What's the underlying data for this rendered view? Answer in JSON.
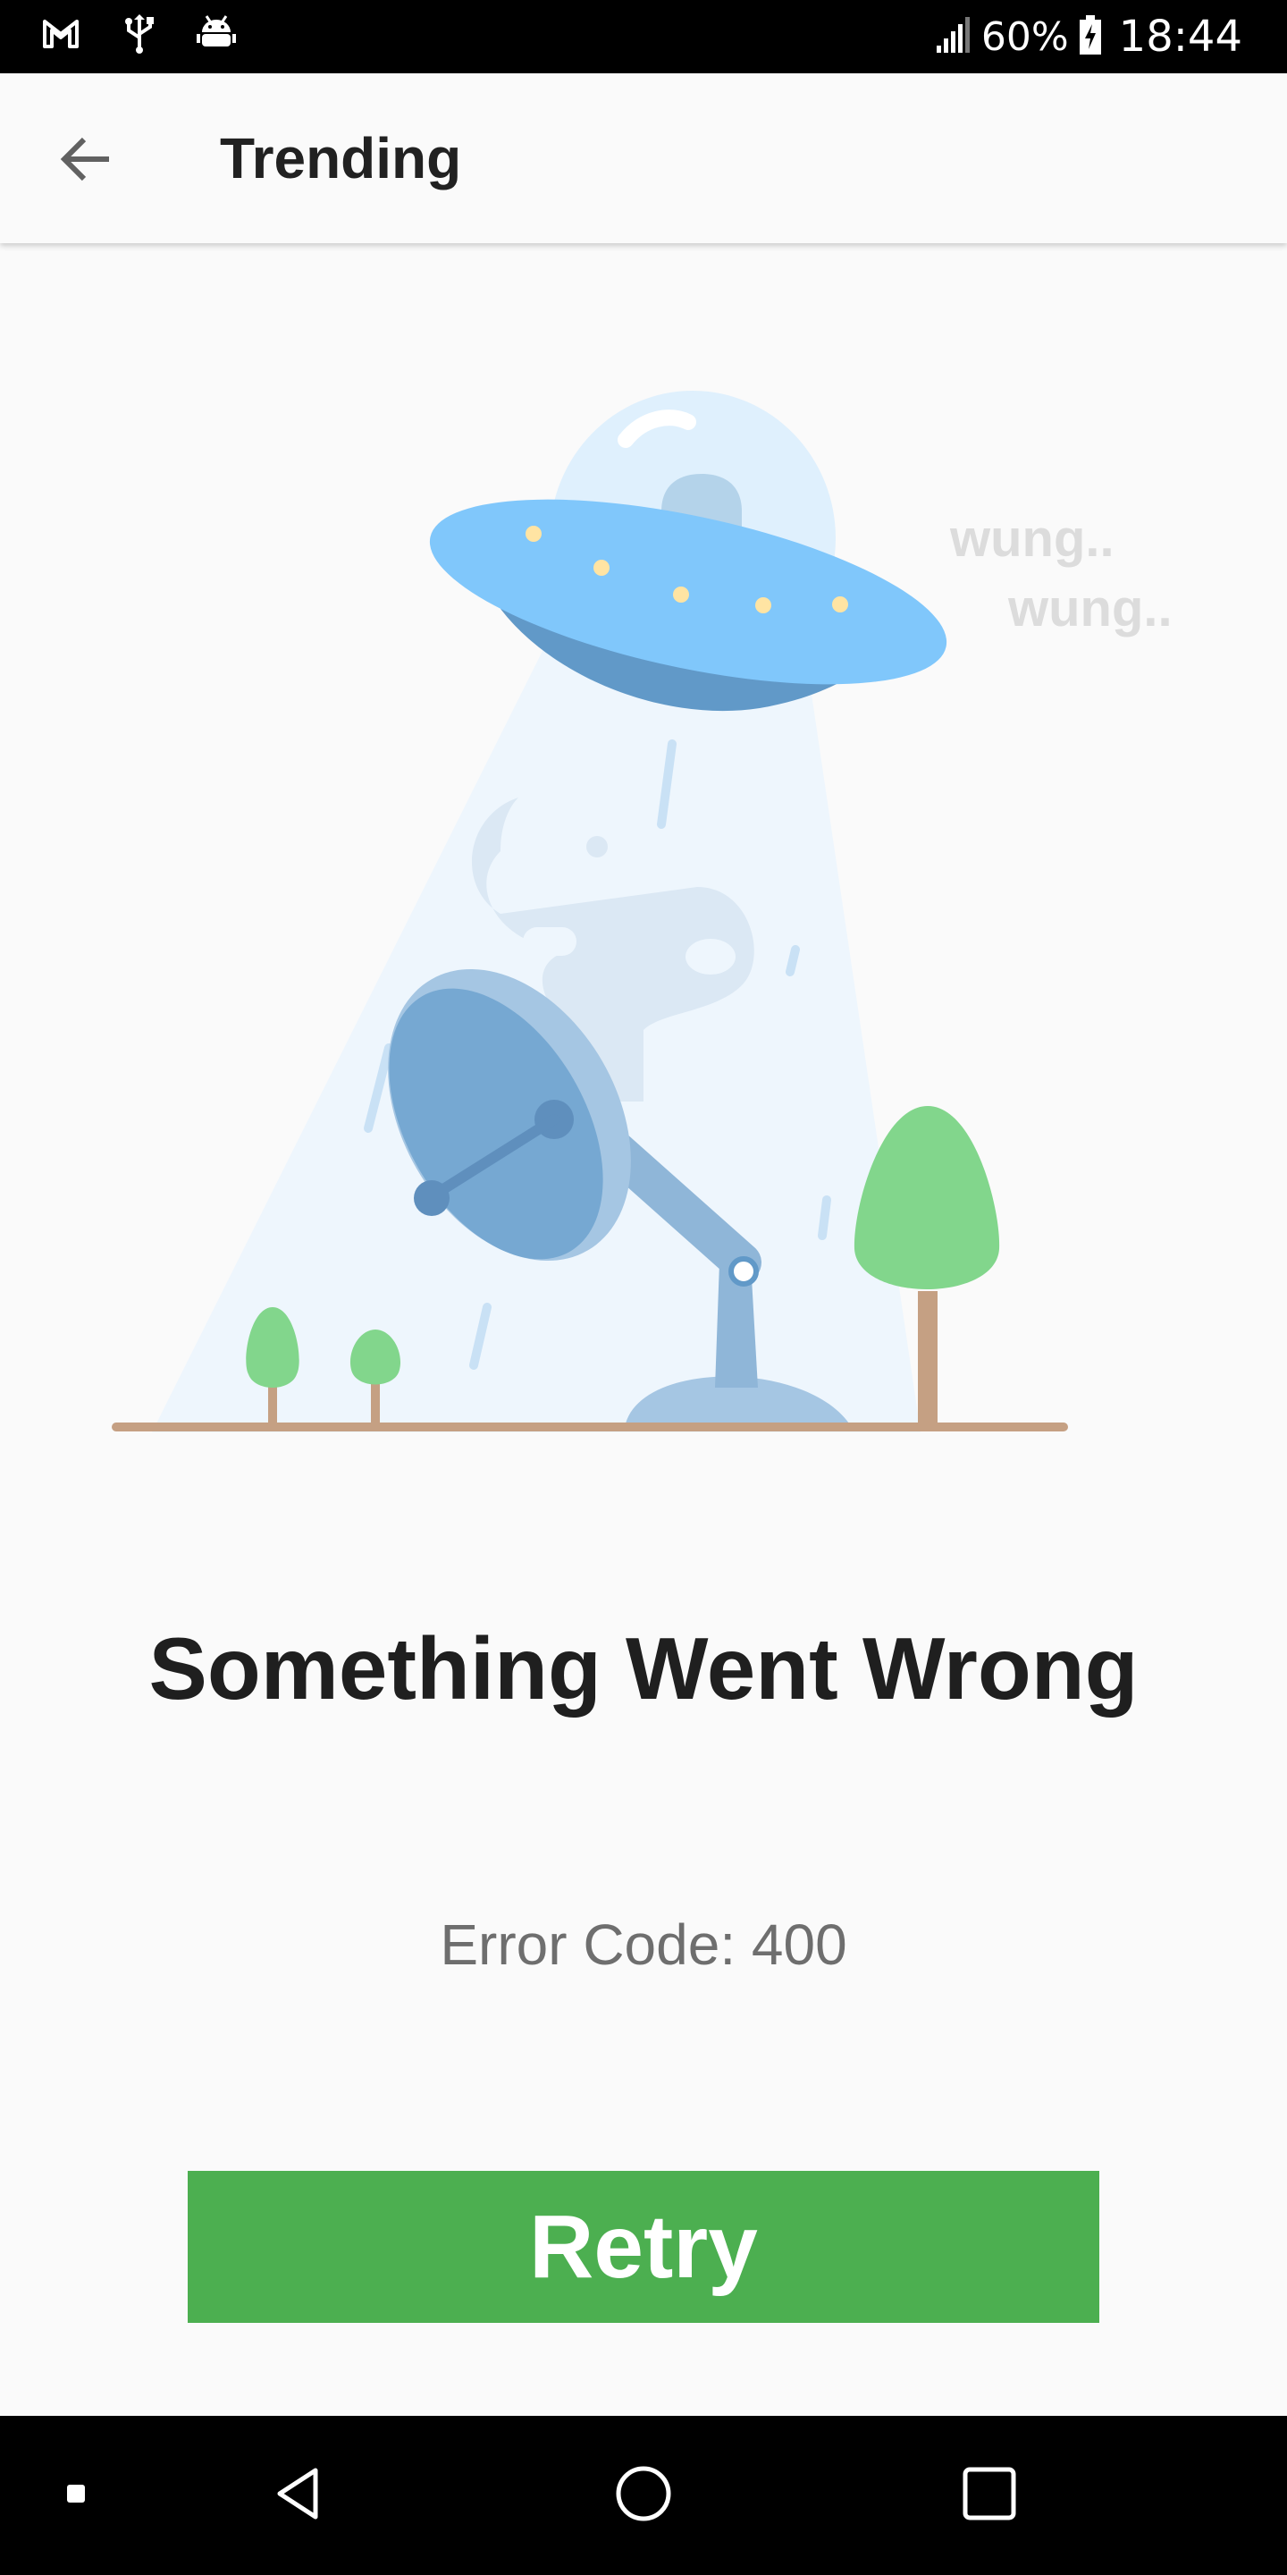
{
  "status_bar": {
    "battery": "60%",
    "time": "18:44",
    "icons": [
      "gmail-icon",
      "usb-icon",
      "android-debug-icon",
      "signal-icon",
      "battery-charging-icon"
    ]
  },
  "app_bar": {
    "title": "Trending",
    "back_icon": "arrow-left-icon"
  },
  "illustration": {
    "sound_line_1": "wung..",
    "sound_line_2": "wung.."
  },
  "error": {
    "title": "Something Went Wrong",
    "code_text": "Error Code: 400"
  },
  "retry": {
    "label": "Retry",
    "color": "#4caf50"
  },
  "nav_bar": {
    "items": [
      "recent-dot-icon",
      "back-triangle-icon",
      "home-circle-icon",
      "overview-square-icon"
    ]
  }
}
